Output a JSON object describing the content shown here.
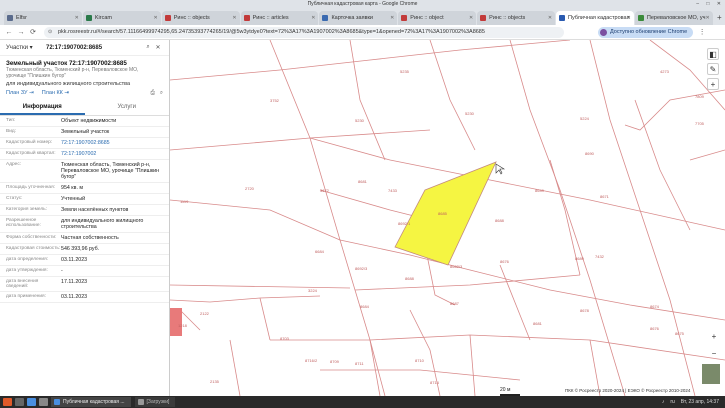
{
  "window": {
    "title": "Публичная кадастровая карта - Google Chrome",
    "minimize": "–",
    "maximize": "□",
    "close": "✕"
  },
  "tabs": [
    {
      "label": "Elfsr",
      "color": "#5a6b8c"
    },
    {
      "label": "Kircam",
      "color": "#2a7a4a"
    },
    {
      "label": "Ринс :: objects",
      "color": "#c23a3a"
    },
    {
      "label": "Ринс :: articles",
      "color": "#c23a3a"
    },
    {
      "label": "Карточка заявки",
      "color": "#3a6ab0"
    },
    {
      "label": "Ринс :: object",
      "color": "#c23a3a"
    },
    {
      "label": "Ринс :: objects",
      "color": "#c23a3a"
    },
    {
      "label": "Публичная кадастровая",
      "color": "#2a5ab0",
      "active": true
    },
    {
      "label": "Переваловское МО, уч",
      "color": "#3a8a3a"
    }
  ],
  "new_tab": "+",
  "toolbar": {
    "back": "←",
    "forward": "→",
    "reload": "⟳",
    "url": "pkk.rosreestr.ru/#/search/57.11166499974295,65.24735393774265/19/@5w3ytdye0?text=72%3A17%3A1907002%3A8685&type=1&opened=72%3A17%3A1907002%3A8685",
    "update_label": "Доступно обновление Chrome",
    "menu": "⋮"
  },
  "search": {
    "type_label": "Участки",
    "dropdown_arrow": "▾",
    "query": "72:17:1907002:8685",
    "search_icon": "⌕",
    "close_icon": "✕"
  },
  "object": {
    "title": "Земельный участок 72:17:1907002:8685",
    "address_short": "Тюменская область, Тюменский р-н, Переваловское МО, урочище \"Плишкин бугор\"",
    "use": "для индивидуального жилищного строительства",
    "plan_zu": "План ЗУ",
    "plan_kk": "План КК",
    "print_icon": "⎙",
    "zoom_icon": "⌕"
  },
  "info_tabs": {
    "info": "Информация",
    "services": "Услуги"
  },
  "props": [
    {
      "k": "Тип:",
      "v": "Объект недвижимости",
      "link": false
    },
    {
      "k": "Вид:",
      "v": "Земельный участок",
      "link": false
    },
    {
      "k": "Кадастровый номер:",
      "v": "72:17:1907002:8685",
      "link": true
    },
    {
      "k": "Кадастровый квартал:",
      "v": "72:17:1907002",
      "link": true
    },
    {
      "k": "Адрес:",
      "v": "Тюменская область, Тюменский р-н, Переваловское МО, урочище \"Плишкин бугор\"",
      "link": false
    },
    {
      "k": "Площадь уточненная:",
      "v": "954 кв. м",
      "link": false
    },
    {
      "k": "Статус:",
      "v": "Учтенный",
      "link": false
    },
    {
      "k": "Категория земель:",
      "v": "Земли населённых пунктов",
      "link": false
    },
    {
      "k": "Разрешенное использование:",
      "v": "для индивидуального жилищного строительства",
      "link": false
    },
    {
      "k": "Форма собственности:",
      "v": "Частная собственность",
      "link": false
    },
    {
      "k": "Кадастровая стоимость:",
      "v": "546 393,96 руб.",
      "link": false
    },
    {
      "k": "дата определения:",
      "v": "03.11.2023",
      "link": false
    },
    {
      "k": "дата утверждения:",
      "v": "-",
      "link": false
    },
    {
      "k": "дата внесения сведений:",
      "v": "17.11.2023",
      "link": false
    },
    {
      "k": "дата применения:",
      "v": "03.11.2023",
      "link": false
    }
  ],
  "map": {
    "parcel_labels": [
      "5235",
      "3752",
      "5230",
      "5230",
      "5224",
      "4273",
      "7809",
      "2720",
      "1119",
      "3672",
      "7433",
      "8681",
      "8685",
      "8688",
      "8649",
      "8690",
      "8671",
      "6684",
      "8692/1",
      "8692/3",
      "8688",
      "8687",
      "8676",
      "8662/3",
      "8684",
      "8689",
      "7432",
      "2122",
      "3224",
      "8703",
      "8678",
      "8674",
      "8681",
      "8676",
      "8675",
      "8709",
      "8711",
      "8716/2",
      "8710",
      "2135",
      "8714",
      "1218",
      "7705"
    ],
    "tools": {
      "layers": "◧",
      "measure": "✎",
      "zoom_in": "+",
      "zoom_in2": "+",
      "zoom_out": "−"
    },
    "scale": "20 м",
    "copyright": "ПКК © Росреестр 2020-2024 | ЕЭКО © Росреестр 2010-2024"
  },
  "taskbar": {
    "task1": "Публичная кадастровая ...",
    "task2": "[Загрузки]",
    "lang": "ru",
    "clock": "Вт, 23 апр, 14:37"
  }
}
